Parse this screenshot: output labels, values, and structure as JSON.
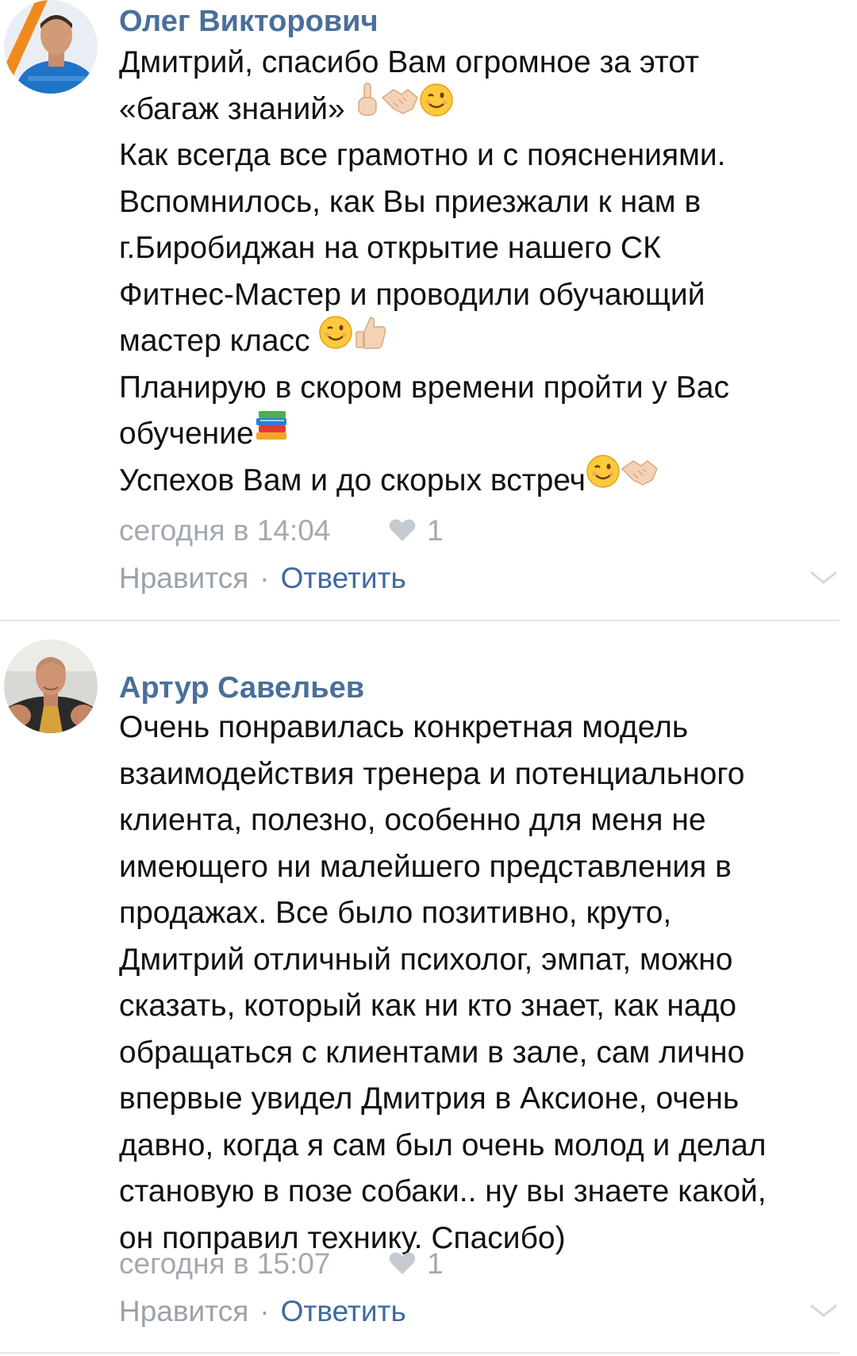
{
  "comments": [
    {
      "author": "Олег Викторович",
      "lines": [
        {
          "text": "Дмитрий, спасибо Вам огромное за этот",
          "emojis": []
        },
        {
          "text": "«багаж знаний» ",
          "emojis": [
            "point-up-emoji",
            "handshake-emoji",
            "wink-emoji"
          ]
        },
        {
          "text": "Как всегда все грамотно и с пояснениями.",
          "emojis": []
        },
        {
          "text": "Вспомнилось, как Вы приезжали к нам в",
          "emojis": []
        },
        {
          "text": "г.Биробиджан на открытие нашего СК",
          "emojis": []
        },
        {
          "text": "Фитнес-Мастер и проводили обучающий",
          "emojis": []
        },
        {
          "text": "мастер класс ",
          "emojis": [
            "wink-emoji",
            "thumbs-up-emoji"
          ]
        },
        {
          "text": "Планирую в скором времени пройти у Вас",
          "emojis": []
        },
        {
          "text": "обучение",
          "emojis": [
            "books-emoji"
          ]
        },
        {
          "text": "Успехов Вам и до скорых встреч",
          "emojis": [
            "wink-emoji",
            "handshake-emoji"
          ]
        }
      ],
      "timestamp": "сегодня в 14:04",
      "like_count": "1",
      "like_label": "Нравится",
      "separator": "·",
      "reply_label": "Ответить"
    },
    {
      "author": "Артур Савельев",
      "lines": [
        {
          "text": "Очень понравилась конкретная модель",
          "emojis": []
        },
        {
          "text": "взаимодействия тренера и потенциального",
          "emojis": []
        },
        {
          "text": "клиента, полезно, особенно для меня не",
          "emojis": []
        },
        {
          "text": "имеющего ни малейшего представления в",
          "emojis": []
        },
        {
          "text": "продажах. Все было позитивно, круто,",
          "emojis": []
        },
        {
          "text": "Дмитрий отличный психолог, эмпат, можно",
          "emojis": []
        },
        {
          "text": "сказать, который как ни кто знает, как надо",
          "emojis": []
        },
        {
          "text": "обращаться с клиентами в зале, сам лично",
          "emojis": []
        },
        {
          "text": "впервые увидел Дмитрия в Аксионе, очень",
          "emojis": []
        },
        {
          "text": "давно, когда я сам был очень молод и делал",
          "emojis": []
        },
        {
          "text": "становую в позе собаки.. ну вы знаете какой,",
          "emojis": []
        },
        {
          "text": "он поправил технику. Спасибо)",
          "emojis": []
        }
      ],
      "timestamp": "сегодня в 15:07",
      "like_count": "1",
      "like_label": "Нравится",
      "separator": "·",
      "reply_label": "Ответить"
    }
  ],
  "colors": {
    "author": "#4a6f99",
    "meta": "#a3a9b0",
    "reply": "#3e6aa0",
    "text": "#111111"
  }
}
